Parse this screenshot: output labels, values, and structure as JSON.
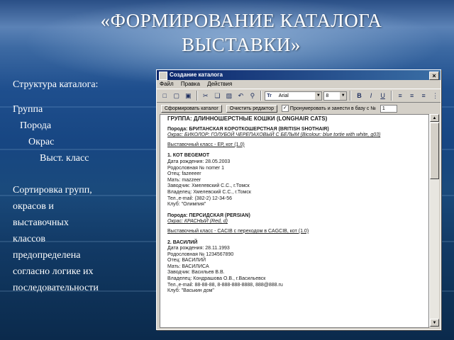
{
  "slide": {
    "title_line1": "«ФОРМИРОВАНИЕ КАТАЛОГА",
    "title_line2": "ВЫСТАВКИ»",
    "left": {
      "heading": "Структура каталога:",
      "hierarchy": [
        "Группа",
        "Порода",
        "Окрас",
        "Выст. класс"
      ],
      "sort_lines": [
        "Сортировка групп,",
        "окрасов и",
        "выставочных",
        "классов",
        "предопределена",
        "согласно логике их",
        "последовательности"
      ]
    }
  },
  "window": {
    "title": "Создание каталога",
    "close_glyph": "×",
    "menu": [
      "Файл",
      "Правка",
      "Действия"
    ],
    "font_combo": "Arial",
    "font_prefix": "Tr",
    "size_combo": "8",
    "buttons": {
      "form": "Сформировать каталог",
      "clear": "Очистить редактор",
      "renumber": "Пронумеровать и занести в базу с №",
      "start_number": "1"
    },
    "renumber_checked": true
  },
  "catalog": {
    "group": "ГРУППА: ДЛИННОШЕРСТНЫЕ КОШКИ (LONGHAIR CATS)",
    "blocks": [
      {
        "breed": "Порода: БРИТАНСКАЯ КОРОТКОШЕРСТНАЯ (BRITISH SHOTHAIR)",
        "color": "Окрас: БИКОЛОР: ГОЛУБОЙ ЧЕРЕПАХОВЫЙ С БЕЛЫМ (Bicolour: blue tortie with white, g03)",
        "class": "Выставочный класс - ЕР, кот (1.0)",
        "entry": {
          "name": "1. КОТ BEGEMOT",
          "lines": [
            "Дата рождения: 28.05.2003",
            "Родословная № nomer 1",
            "Отец: fazeeeer",
            "Мать: mazzeer",
            "Заводчик: Хмелевский С.С., г.Томск",
            "Владелец: Хмелевский С.С., г.Томск",
            "Тел.,e-mail: (382-2) 12-34-56",
            "Клуб: \"Олимпия\""
          ]
        }
      },
      {
        "breed": "Порода: ПЕРСИДСКАЯ (PERSIAN)",
        "color": "Окрас: КРАСНЫЙ (Red, d)",
        "class": "Выставочный класс - CACIB с переходом в CAGCIB, кот (1.0)",
        "entry": {
          "name": "2. ВАСИЛИЙ",
          "lines": [
            "Дата рождения: 28.11.1993",
            "Родословная № 1234567890",
            "Отец: ВАСИЛИЙ",
            "Мать: ВАСИЛИСА",
            "Заводчик: Васильев В.В.",
            "Владелец: Кондрашова О.В., г.Васильевск",
            "Тел.,e-mail: 88-88-88, 8-888-888-8888, 888@888.ru",
            "Клуб: \"Васькин дом\""
          ]
        }
      }
    ]
  }
}
